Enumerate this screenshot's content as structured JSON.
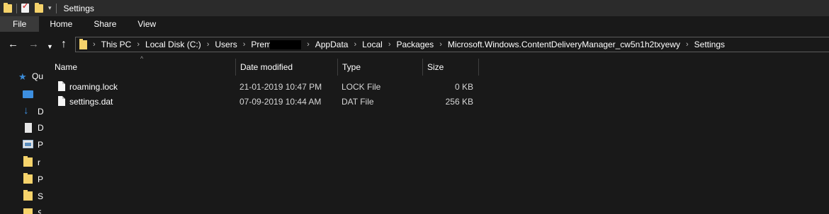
{
  "window": {
    "title": "Settings"
  },
  "ribbon": {
    "tabs": [
      "File",
      "Home",
      "Share",
      "View"
    ]
  },
  "address": {
    "crumbs": [
      "This PC",
      "Local Disk (C:)",
      "Users",
      "Prem",
      "AppData",
      "Local",
      "Packages",
      "Microsoft.Windows.ContentDeliveryManager_cw5n1h2txyewy",
      "Settings"
    ]
  },
  "navpane": {
    "items": [
      {
        "icon": "star-icon",
        "label": "Qu"
      },
      {
        "icon": "desktop-icon",
        "label": ""
      },
      {
        "icon": "download-icon",
        "label": "D"
      },
      {
        "icon": "document-icon",
        "label": "D"
      },
      {
        "icon": "picture-icon",
        "label": "P"
      },
      {
        "icon": "folder-icon",
        "label": "r"
      },
      {
        "icon": "folder-icon",
        "label": "P"
      },
      {
        "icon": "folder-icon",
        "label": "S"
      },
      {
        "icon": "folder-icon",
        "label": "S"
      }
    ]
  },
  "table": {
    "columns": [
      "Name",
      "Date modified",
      "Type",
      "Size"
    ],
    "rows": [
      {
        "name": "roaming.lock",
        "date": "21-01-2019 10:47 PM",
        "type": "LOCK File",
        "size": "0 KB"
      },
      {
        "name": "settings.dat",
        "date": "07-09-2019 10:44 AM",
        "type": "DAT File",
        "size": "256 KB"
      }
    ]
  },
  "colors": {
    "background": "#191919",
    "folder": "#f6d36b",
    "accent": "#3d8fe0"
  }
}
